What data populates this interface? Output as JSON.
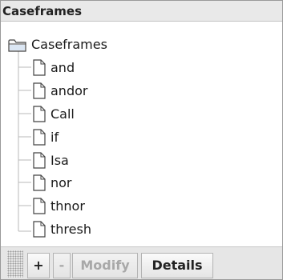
{
  "header": {
    "title": "Caseframes"
  },
  "tree": {
    "root": {
      "label": "Caseframes",
      "icon": "folder-icon"
    },
    "children": [
      {
        "label": "and",
        "icon": "document-icon"
      },
      {
        "label": "andor",
        "icon": "document-icon"
      },
      {
        "label": "Call",
        "icon": "document-icon"
      },
      {
        "label": "if",
        "icon": "document-icon"
      },
      {
        "label": "Isa",
        "icon": "document-icon"
      },
      {
        "label": "nor",
        "icon": "document-icon"
      },
      {
        "label": "thnor",
        "icon": "document-icon"
      },
      {
        "label": "thresh",
        "icon": "document-icon"
      }
    ]
  },
  "toolbar": {
    "add_label": "+",
    "remove_label": "-",
    "modify_label": "Modify",
    "details_label": "Details"
  }
}
